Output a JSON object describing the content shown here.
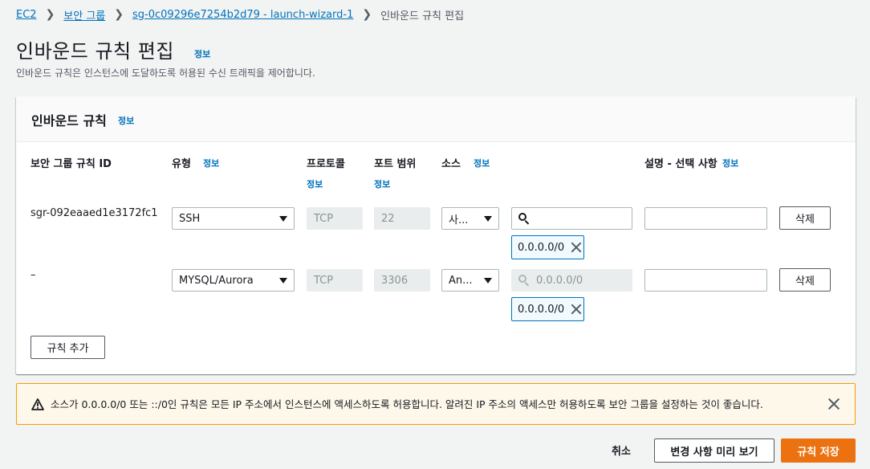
{
  "breadcrumb": {
    "items": [
      "EC2",
      "보안 그룹",
      "sg-0c09296e7254b2d79 - launch-wizard-1"
    ],
    "current": "인바운드 규칙 편집"
  },
  "page": {
    "title": "인바운드 규칙 편집",
    "info": "정보",
    "description": "인바운드 규칙은 인스턴스에 도달하도록 허용된 수신 트래픽을 제어합니다."
  },
  "panel": {
    "title": "인바운드 규칙",
    "info": "정보",
    "columns": {
      "rule_id": "보안 그룹 규칙 ID",
      "type": "유형",
      "type_info": "정보",
      "protocol": "프로토콜",
      "protocol_info": "정보",
      "port_range": "포트 범위",
      "port_range_info": "정보",
      "source": "소스",
      "source_info": "정보",
      "description": "설명 - 선택 사항",
      "description_info": "정보"
    },
    "rules": [
      {
        "rule_id": "sgr-092eaaed1e3172fc1",
        "type": "SSH",
        "protocol": "TCP",
        "port": "22",
        "source_select": "사...",
        "source_search": "",
        "source_token": "0.0.0.0/0",
        "description": "",
        "delete_label": "삭제"
      },
      {
        "rule_id": "–",
        "type": "MYSQL/Aurora",
        "protocol": "TCP",
        "port": "3306",
        "source_select": "An...",
        "source_search_placeholder": "0.0.0.0/0",
        "source_token": "0.0.0.0/0",
        "description": "",
        "delete_label": "삭제"
      }
    ],
    "add_rule_label": "규칙 추가"
  },
  "alert": {
    "text": "소스가 0.0.0.0/0 또는 ::/0인 규칙은 모든 IP 주소에서 인스턴스에 액세스하도록 허용합니다. 알려진 IP 주소의 액세스만 허용하도록 보안 그룹을 설정하는 것이 좋습니다."
  },
  "footer": {
    "cancel_label": "취소",
    "preview_label": "변경 사항 미리 보기",
    "save_label": "규칙 저장"
  },
  "colors": {
    "link": "#0073bb",
    "primary": "#ec7211",
    "warning_border": "#ff9900",
    "warning_bg": "#fef8eb"
  }
}
